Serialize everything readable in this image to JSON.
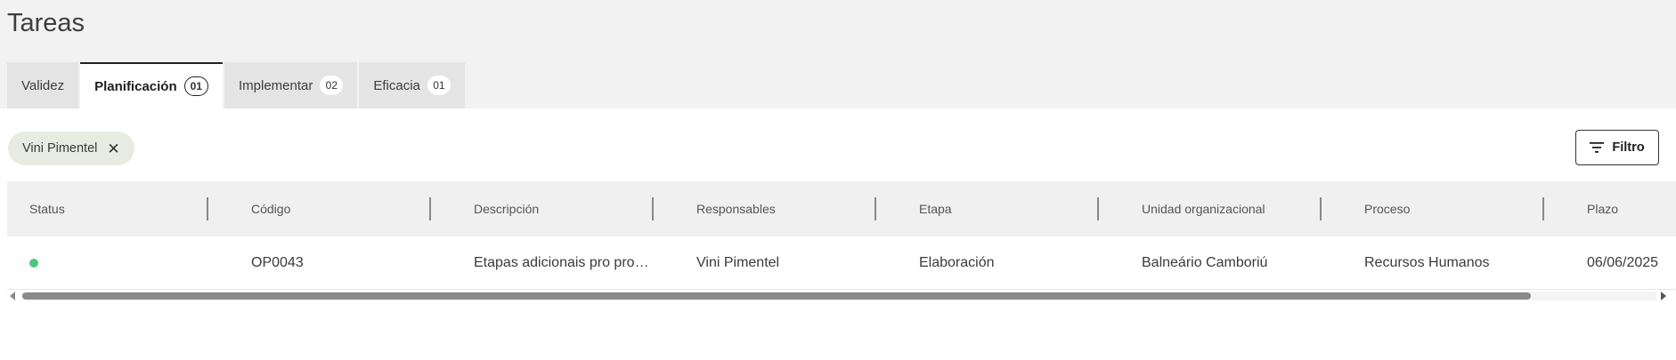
{
  "page": {
    "title": "Tareas"
  },
  "tabs": [
    {
      "label": "Validez",
      "count": ""
    },
    {
      "label": "Planificación",
      "count": "01",
      "active": true
    },
    {
      "label": "Implementar",
      "count": "02"
    },
    {
      "label": "Eficacia",
      "count": "01"
    }
  ],
  "filter_chip": {
    "label": "Vini Pimentel",
    "remove_icon": "close-icon"
  },
  "filter_button": {
    "label": "Filtro",
    "icon": "filter-list-icon"
  },
  "table": {
    "columns": [
      "Status",
      "Código",
      "Descripción",
      "Responsables",
      "Etapa",
      "Unidad organizacional",
      "Proceso",
      "Plazo"
    ],
    "rows": [
      {
        "status_color": "#4cca7b",
        "codigo": "OP0043",
        "descripcion": "Etapas adicionais pro processo",
        "responsables": "Vini Pimentel",
        "etapa": "Elaboración",
        "unidad": "Balneário Camboriú",
        "proceso": "Recursos Humanos",
        "plazo": "06/06/2025"
      }
    ]
  },
  "colors": {
    "accent": "#222222",
    "status_green": "#4cca7b",
    "chip_bg": "#e8ebe1"
  }
}
